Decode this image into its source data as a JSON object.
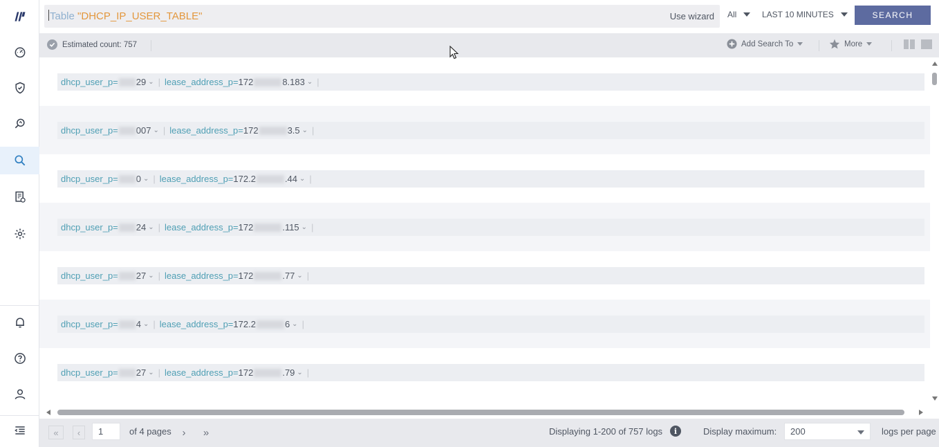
{
  "query": {
    "keyword": "Table",
    "table": "\"DHCP_IP_USER_TABLE\"",
    "use_wizard": "Use wizard"
  },
  "scope": {
    "selected": "All"
  },
  "time_range": {
    "selected": "LAST 10 MINUTES"
  },
  "search_button": "SEARCH",
  "toolbar": {
    "estimated_count": "Estimated count: 757",
    "add_search_to": "Add Search To",
    "more": "More"
  },
  "rows": [
    {
      "user_key": "dhcp_user_p=",
      "user_vis_end": "29",
      "lease_key": "lease_address_p=",
      "lease_vis_start": "172",
      "lease_vis_end": "8.183"
    },
    {
      "user_key": "dhcp_user_p=",
      "user_vis_end": "007",
      "lease_key": "lease_address_p=",
      "lease_vis_start": "172",
      "lease_vis_end": "3.5"
    },
    {
      "user_key": "dhcp_user_p=",
      "user_vis_end": "0",
      "lease_key": "lease_address_p=",
      "lease_vis_start": "172.2",
      "lease_vis_end": ".44"
    },
    {
      "user_key": "dhcp_user_p=",
      "user_vis_end": "24",
      "lease_key": "lease_address_p=",
      "lease_vis_start": "172",
      "lease_vis_end": ".115"
    },
    {
      "user_key": "dhcp_user_p=",
      "user_vis_end": "27",
      "lease_key": "lease_address_p=",
      "lease_vis_start": "172",
      "lease_vis_end": ".77"
    },
    {
      "user_key": "dhcp_user_p=",
      "user_vis_end": "4",
      "lease_key": "lease_address_p=",
      "lease_vis_start": "172.2",
      "lease_vis_end": "6"
    },
    {
      "user_key": "dhcp_user_p=",
      "user_vis_end": "27",
      "lease_key": "lease_address_p=",
      "lease_vis_start": "172",
      "lease_vis_end": ".79"
    }
  ],
  "pagination": {
    "current_page": "1",
    "of_pages": "of 4 pages",
    "displaying": "Displaying 1-200 of 757 logs",
    "display_max_label": "Display maximum:",
    "display_max_value": "200",
    "per_page_label": "logs per page"
  },
  "colors": {
    "accent": "#5d6ba0",
    "field_key": "#4f9fb4",
    "query_table": "#e3973d",
    "active_nav": "#e8f1fb"
  },
  "icons": {
    "sidebar": [
      "logo-icon",
      "dashboard-icon",
      "shield-icon",
      "investigate-icon",
      "search-icon",
      "report-icon",
      "settings-icon",
      "bell-icon",
      "help-icon",
      "user-icon",
      "collapse-menu-icon"
    ]
  }
}
